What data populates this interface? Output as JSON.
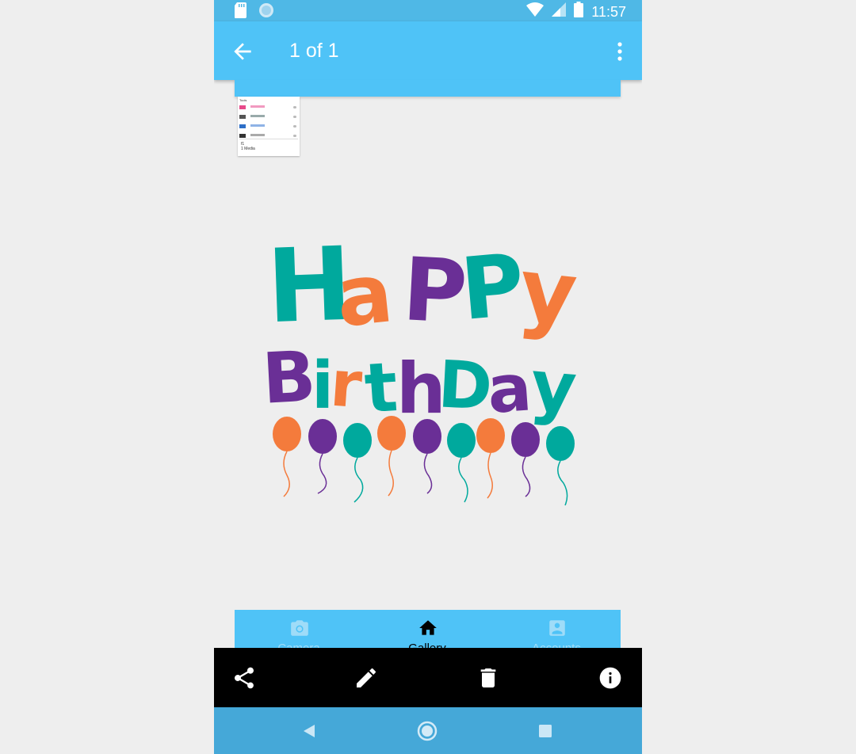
{
  "status_bar": {
    "time": "11:57",
    "icons": [
      "sd-card-icon",
      "sync-circle-icon",
      "wifi-icon",
      "cell-signal-icon",
      "battery-icon"
    ]
  },
  "app_bar": {
    "title": "1 of 1",
    "icons": [
      "back-arrow-icon",
      "more-vert-icon"
    ],
    "color": "#4fc3f7"
  },
  "thumbnail": {
    "header": "Tools",
    "footer_line1": "f1",
    "footer_line2": "1 Media"
  },
  "image": {
    "line1": "Happy",
    "line2": "Birthday",
    "colors": {
      "teal": "#00a99d",
      "orange": "#f47b3c",
      "purple": "#6a2f96"
    }
  },
  "under_nav": {
    "items": [
      {
        "label": "Camera",
        "icon": "camera-icon"
      },
      {
        "label": "Gallery",
        "icon": "home-icon"
      },
      {
        "label": "Accounts",
        "icon": "account-box-icon"
      }
    ]
  },
  "action_bar": {
    "icons": [
      "share-icon",
      "edit-pencil-icon",
      "delete-trash-icon",
      "info-icon"
    ]
  },
  "system_nav": {
    "icons": [
      "nav-back-triangle-icon",
      "nav-home-circle-icon",
      "nav-recents-square-icon"
    ],
    "color": "#45a8d8"
  }
}
